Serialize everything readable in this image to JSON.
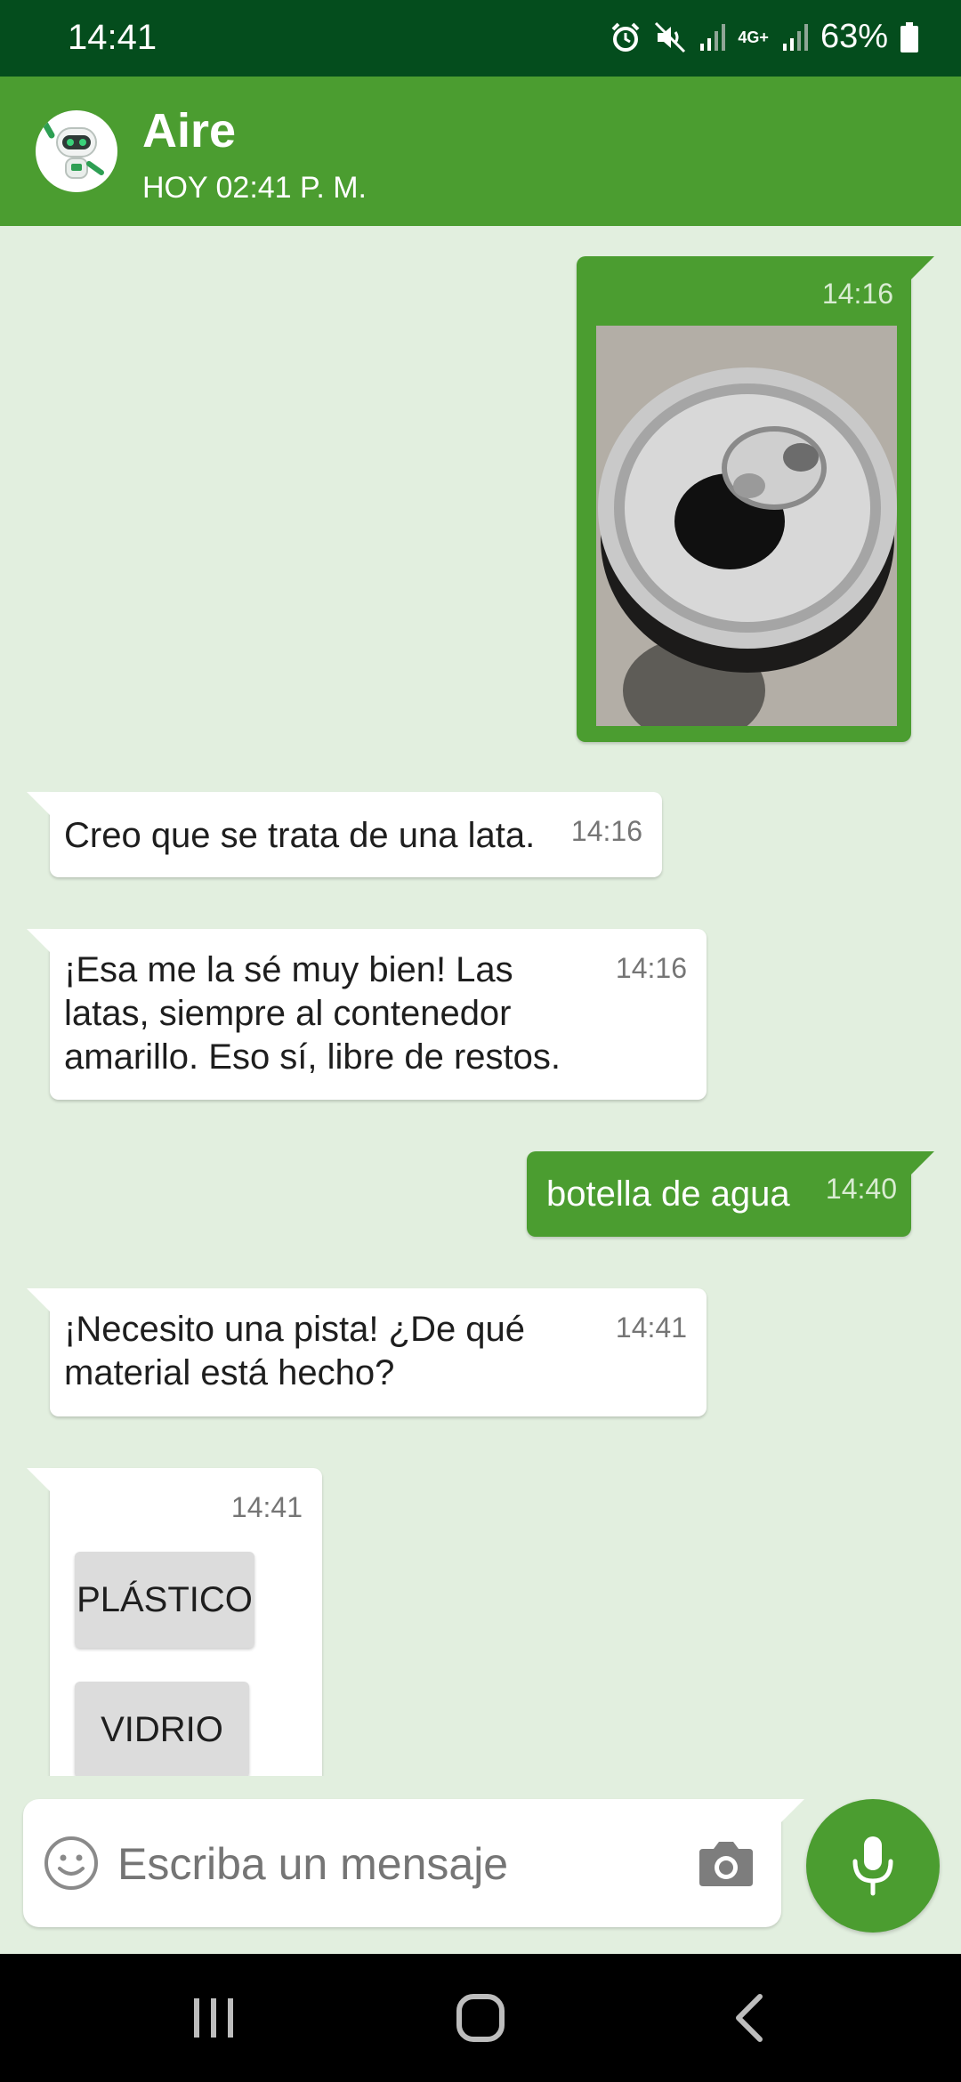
{
  "status_bar": {
    "time": "14:41",
    "network": "4G+",
    "battery": "63%",
    "icons": [
      "alarm-icon",
      "mute-icon",
      "signal-icon",
      "signal-icon",
      "battery-icon"
    ]
  },
  "header": {
    "title": "Aire",
    "subtitle": "HOY 02:41 P. M."
  },
  "messages": [
    {
      "type": "image",
      "direction": "out",
      "time": "14:16",
      "image_subject": "open-aluminum-can"
    },
    {
      "type": "text",
      "direction": "in",
      "text": "Creo que se trata de una lata.",
      "time": "14:16"
    },
    {
      "type": "text",
      "direction": "in",
      "text": "¡Esa me la sé muy bien! Las latas, siempre al contenedor amarillo. Eso sí, libre de restos.",
      "time": "14:16"
    },
    {
      "type": "text",
      "direction": "out",
      "text": "botella de agua",
      "time": "14:40"
    },
    {
      "type": "text",
      "direction": "in",
      "text": "¡Necesito una pista! ¿De qué material está hecho?",
      "time": "14:41"
    },
    {
      "type": "options",
      "direction": "in",
      "time": "14:41",
      "options": [
        "PLÁSTICO",
        "VIDRIO"
      ]
    }
  ],
  "input": {
    "placeholder": "Escriba un mensaje"
  },
  "colors": {
    "status_bar": "#044d1d",
    "header": "#4b9d30",
    "chat_background": "#e2efdf",
    "outgoing_bubble": "#4b9d30",
    "incoming_bubble": "#ffffff"
  }
}
